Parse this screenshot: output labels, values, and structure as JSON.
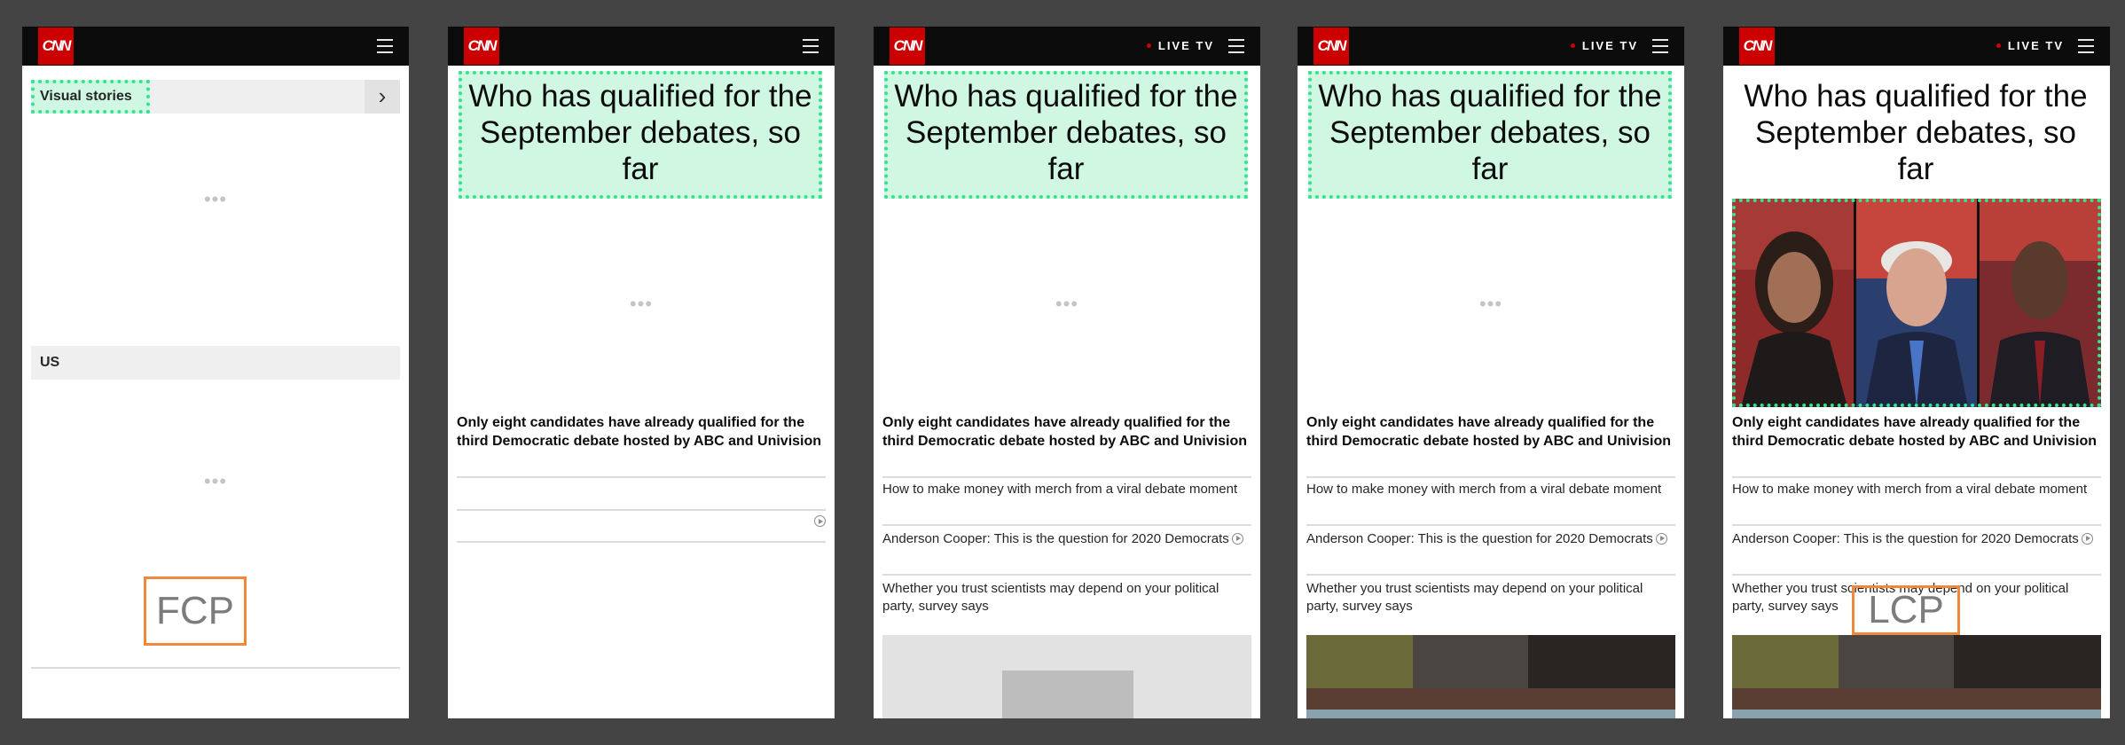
{
  "brand": {
    "logo_text": "CNN",
    "live_label": "LIVE TV"
  },
  "frames": [
    {
      "id": "frame-1",
      "section_visual": "Visual stories",
      "section_us": "US",
      "marker": "FCP"
    },
    {
      "id": "frame-2"
    },
    {
      "id": "frame-3"
    },
    {
      "id": "frame-4"
    },
    {
      "id": "frame-5",
      "marker": "LCP"
    }
  ],
  "article": {
    "headline": "Who has qualified for the September debates, so far",
    "lead": "Only eight candidates have already qualified for the third Democratic debate hosted by ABC and Univision",
    "related": [
      "How to make money with merch from a viral debate moment",
      "Anderson Cooper: This is the question for 2020 Democrats",
      "Whether you trust scientists may depend on your political party, survey says"
    ]
  },
  "colors": {
    "brand_red": "#cc0000",
    "highlight_fill": "#cff7e2",
    "highlight_border": "#34e38f",
    "marker_border": "#f0883a",
    "backdrop": "#444444"
  },
  "icons": [
    "menu-icon",
    "chevron-right-icon",
    "play-icon",
    "live-dot-icon"
  ]
}
